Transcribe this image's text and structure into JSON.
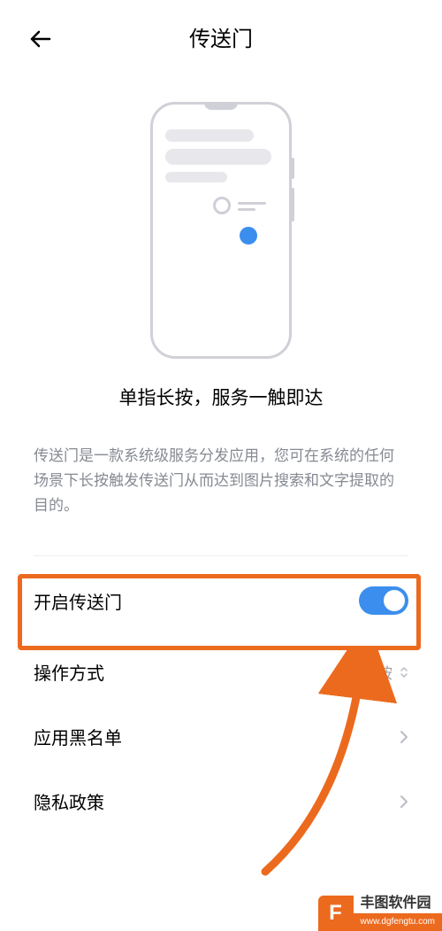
{
  "header": {
    "title": "传送门"
  },
  "illustration": {
    "caption": "单指长按，服务一触即达"
  },
  "description": "传送门是一款系统级服务分发应用，您可在系统的任何场景下长按触发传送门从而达到图片搜索和文字提取的目的。",
  "settings": {
    "enable": {
      "label": "开启传送门",
      "on": true
    },
    "operation": {
      "label": "操作方式",
      "value": "单指长按"
    },
    "blacklist": {
      "label": "应用黑名单"
    },
    "privacy": {
      "label": "隐私政策"
    }
  },
  "watermark": {
    "label": "丰图软件园",
    "url": "www.dgfengtu.com"
  },
  "annotation": {
    "highlight_color": "#ec6a1e"
  }
}
